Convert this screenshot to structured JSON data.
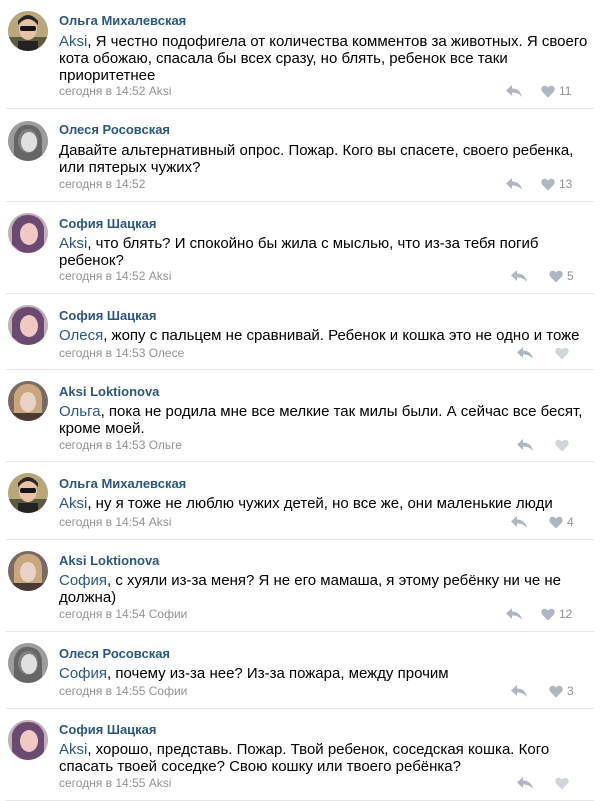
{
  "comments": [
    {
      "author": "Ольга Михалевская",
      "reply_to": "Aksi",
      "body": ", Я честно подофигела от количества комментов за животных. Я своего кота обожаю, спасала бы всех сразу, но блять, ребенок все таки приоритетнее",
      "meta": "сегодня в 14:52 Aksi",
      "likes": "11",
      "avatar": "avatar-olga"
    },
    {
      "author": "Олеся Росовская",
      "reply_to": "",
      "body": "Давайте альтернативный опрос. Пожар. Кого вы спасете, своего ребенка, или пятерых чужих?",
      "meta": "сегодня в 14:52",
      "likes": "13",
      "avatar": "avatar-olesya"
    },
    {
      "author": "София Шацкая",
      "reply_to": "Aksi",
      "body": ", что блять? И спокойно бы жила с мыслью, что из-за тебя погиб ребенок?",
      "meta": "сегодня в 14:52 Aksi",
      "likes": "5",
      "avatar": "avatar-sofia"
    },
    {
      "author": "София Шацкая",
      "reply_to": "Олеся",
      "body": ", жопу с пальцем не сравнивай. Ребенок и кошка это не одно и тоже",
      "meta": "сегодня в 14:53 Олесе",
      "likes": "",
      "avatar": "avatar-sofia"
    },
    {
      "author": "Aksi Loktionova",
      "reply_to": "Ольга",
      "body": ", пока не родила мне все мелкие так милы были. А сейчас все бесят, кроме моей.",
      "meta": "сегодня в 14:53 Ольге",
      "likes": "",
      "avatar": "avatar-aksi"
    },
    {
      "author": "Ольга Михалевская",
      "reply_to": "Aksi",
      "body": ", ну я тоже не люблю чужих детей, но все же, они маленькие люди",
      "meta": "сегодня в 14:54 Aksi",
      "likes": "4",
      "avatar": "avatar-olga"
    },
    {
      "author": "Aksi Loktionova",
      "reply_to": "София",
      "body": ", с хуяли из-за меня? Я не его мамаша, я этому ребёнку ни че не должна)",
      "meta": "сегодня в 14:54 Софии",
      "likes": "12",
      "avatar": "avatar-aksi"
    },
    {
      "author": "Олеся Росовская",
      "reply_to": "София",
      "body": ", почему из-за нее? Из-за  пожара, между прочим",
      "meta": "сегодня в 14:55 Софии",
      "likes": "3",
      "avatar": "avatar-olesya"
    },
    {
      "author": "София Шацкая",
      "reply_to": "Aksi",
      "body": ", хорошо, представь. Пожар. Твой ребенок, соседская кошка. Кого спасать твоей соседке? Свою кошку или твоего ребёнка?",
      "meta": "сегодня в 14:55 Aksi",
      "likes": "",
      "avatar": "avatar-sofia"
    }
  ],
  "icons": {
    "reply": "reply-arrow-icon",
    "like": "heart-icon"
  },
  "colors": {
    "link": "#2a5885",
    "meta": "#939393",
    "icon": "#aeb7c2",
    "divider": "#e3e6ea"
  }
}
